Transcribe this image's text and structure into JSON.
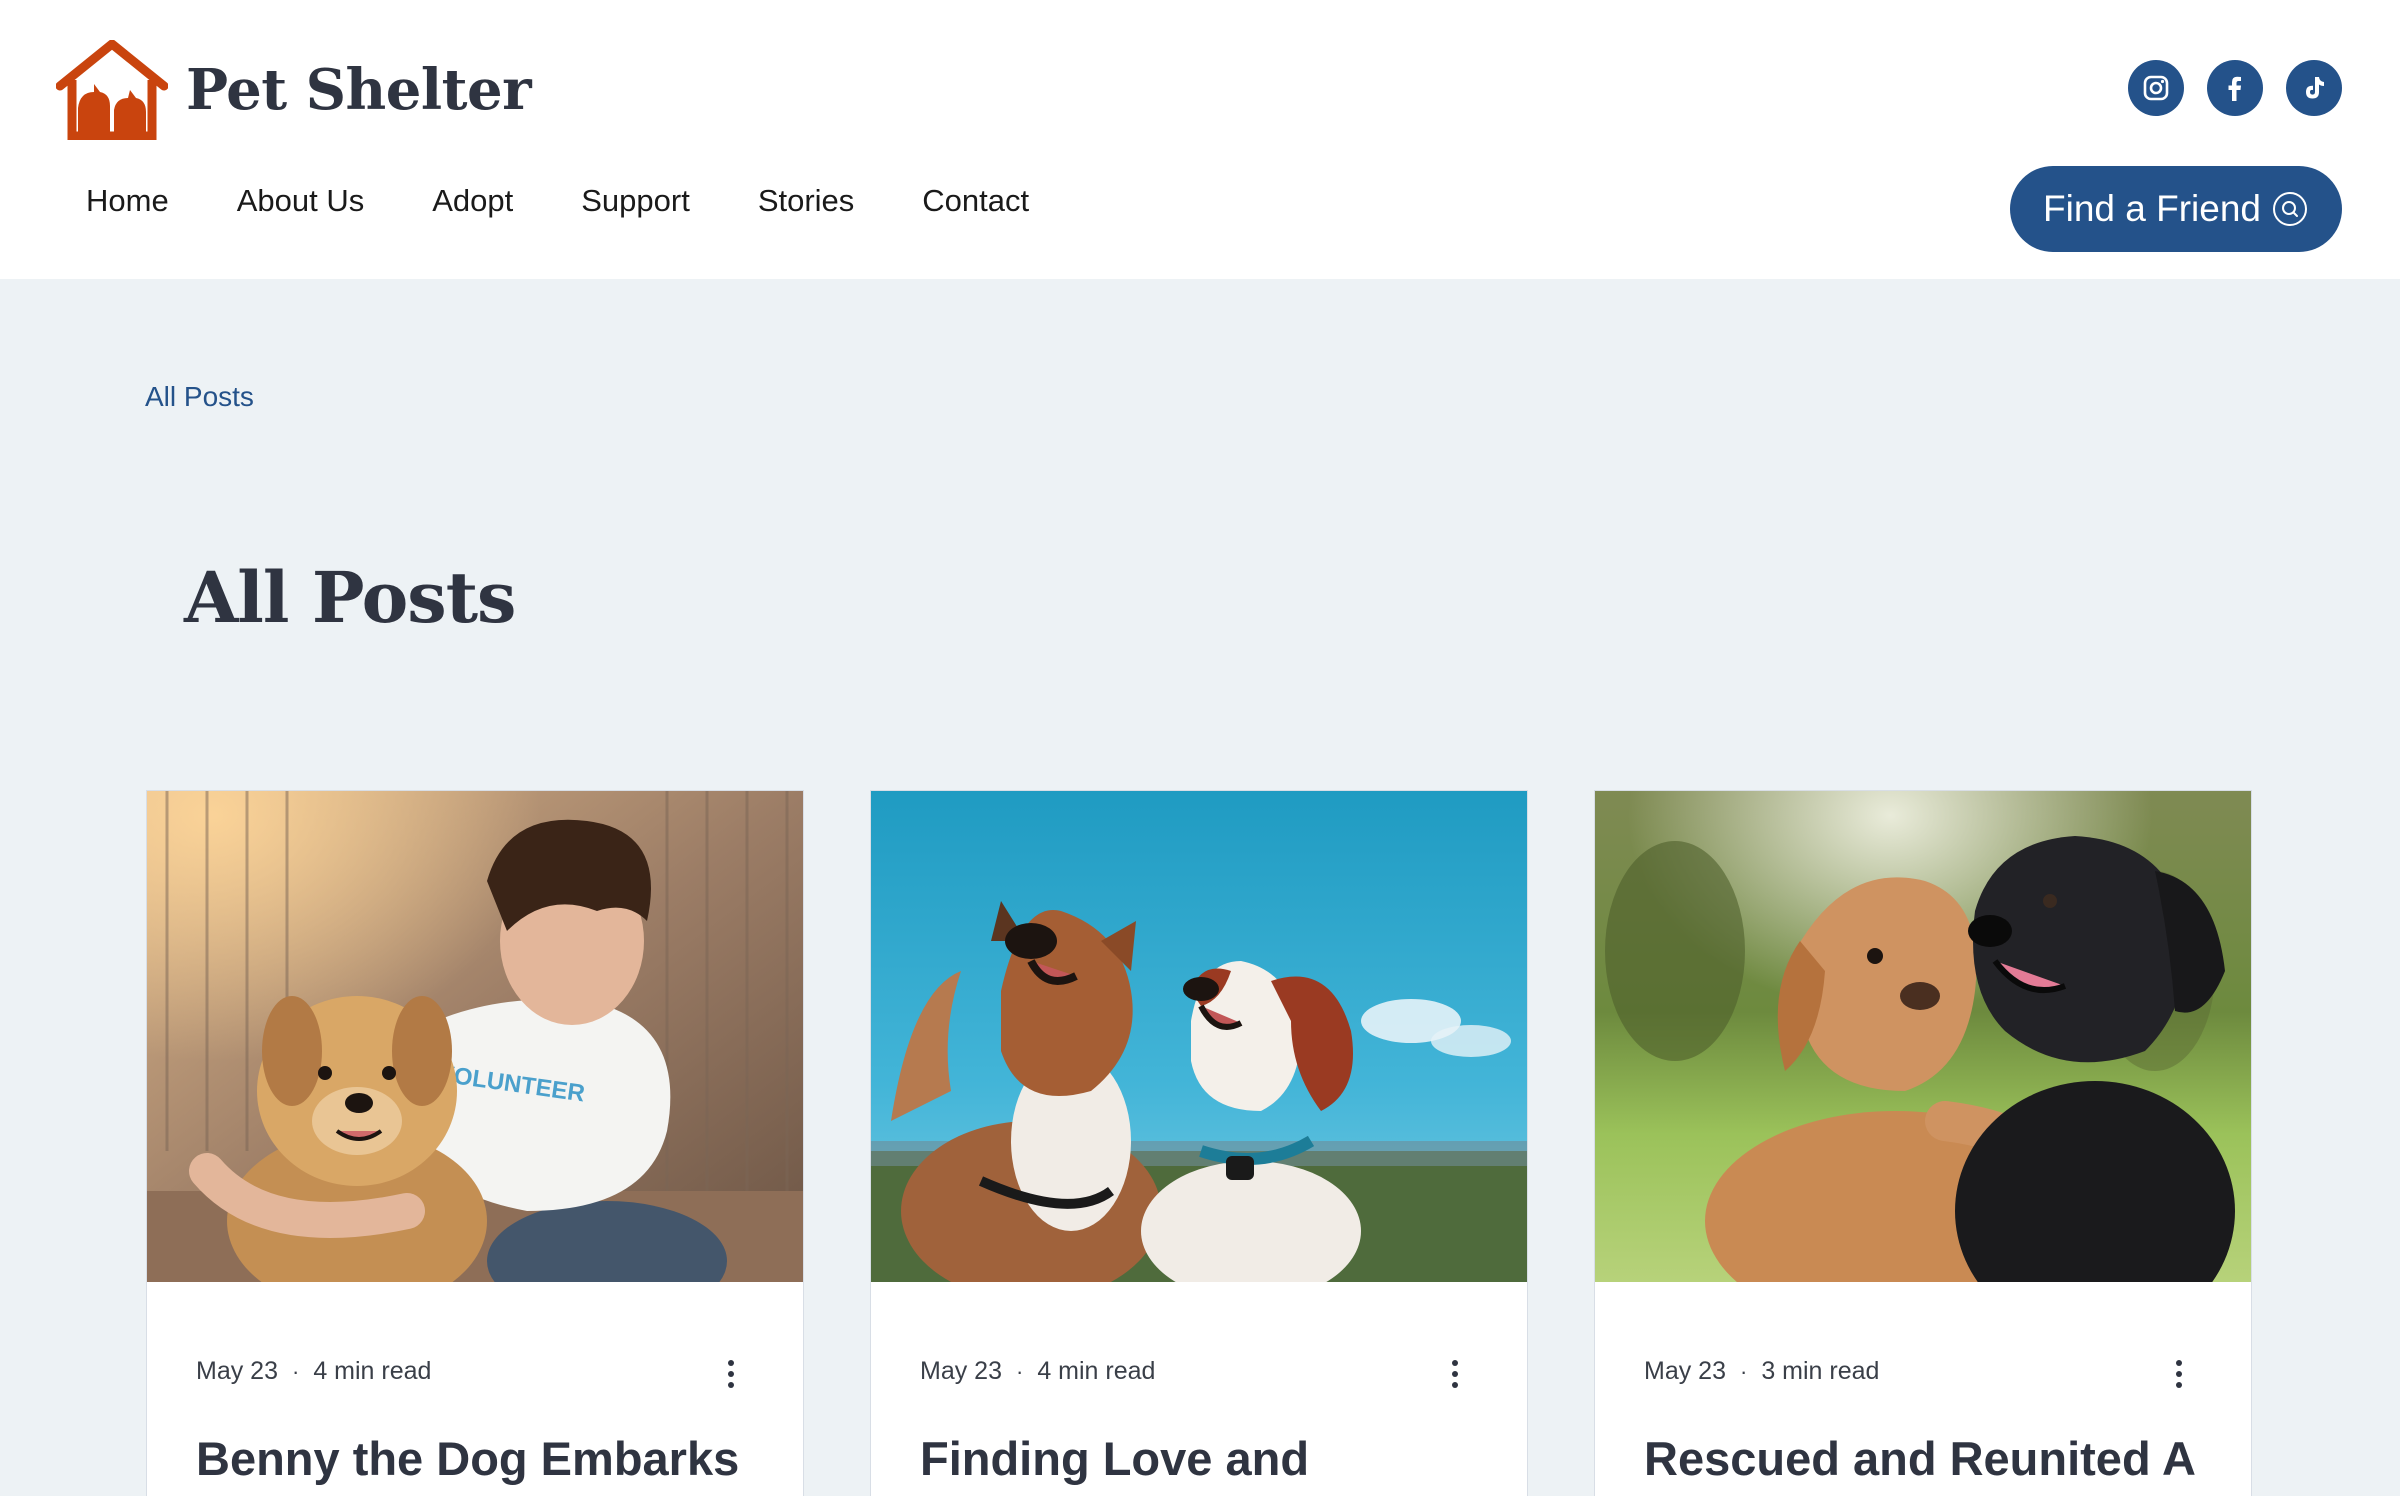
{
  "brand": {
    "name": "Pet Shelter",
    "accent": "#24528a",
    "logo_color": "#c9440e"
  },
  "social": [
    {
      "icon": "instagram-icon",
      "label": "Instagram"
    },
    {
      "icon": "facebook-icon",
      "label": "Facebook"
    },
    {
      "icon": "tiktok-icon",
      "label": "TikTok"
    }
  ],
  "nav": {
    "items": [
      "Home",
      "About Us",
      "Adopt",
      "Support",
      "Stories",
      "Contact"
    ]
  },
  "cta": {
    "label": "Find a Friend",
    "icon": "search-icon"
  },
  "breadcrumb": "All Posts",
  "page_title": "All Posts",
  "posts": [
    {
      "date": "May 23",
      "read_time": "4 min read",
      "title": "Benny the Dog Embarks",
      "image": "volunteer-with-golden-dog"
    },
    {
      "date": "May 23",
      "read_time": "4 min read",
      "title": "Finding Love and",
      "image": "two-dogs-blue-sky"
    },
    {
      "date": "May 23",
      "read_time": "3 min read",
      "title": "Rescued and Reunited A",
      "image": "puppies-in-park"
    }
  ]
}
